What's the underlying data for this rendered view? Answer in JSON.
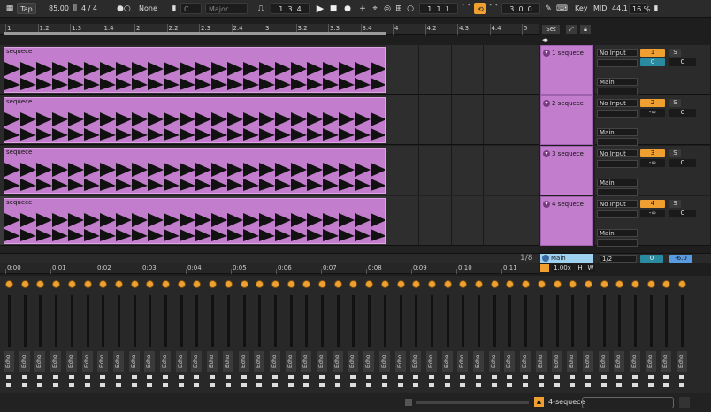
{
  "transport": {
    "tap": "Tap",
    "tempo": "85.00",
    "time_sig": "4 / 4",
    "quantize": "None",
    "key_root": "C",
    "scale": "Major",
    "position": "1.  3.  4",
    "loop_start": "1.  1.  1",
    "loop_length": "3.  0.  0",
    "key_label": "Key",
    "midi_label": "MIDI",
    "sample_rate": "44.1",
    "cpu": "16 %"
  },
  "ruler": {
    "bar_labels": [
      "1",
      "1.2",
      "1.3",
      "1.4",
      "2",
      "2.2",
      "2.3",
      "2.4",
      "3",
      "3.2",
      "3.3",
      "3.4",
      "4",
      "4.2",
      "4.3",
      "4.4",
      "5"
    ]
  },
  "right_panel": {
    "set_label": "Set"
  },
  "tracks": [
    {
      "clip_name": "sequece",
      "track_name": "1 sequece",
      "input": "No Input",
      "output": "Main",
      "number": "1",
      "volume": "0",
      "s": "S",
      "c": "C",
      "armed": true
    },
    {
      "clip_name": "sequece",
      "track_name": "2 sequece",
      "input": "No Input",
      "output": "Main",
      "number": "2",
      "volume": "-∞",
      "s": "S",
      "c": "C",
      "armed": false
    },
    {
      "clip_name": "sequece",
      "track_name": "3 sequece",
      "input": "No Input",
      "output": "Main",
      "number": "3",
      "volume": "-∞",
      "s": "S",
      "c": "C",
      "armed": false
    },
    {
      "clip_name": "sequece",
      "track_name": "4 sequece",
      "input": "No Input",
      "output": "Main",
      "number": "4",
      "volume": "-∞",
      "s": "S",
      "c": "C",
      "armed": false
    }
  ],
  "main_track": {
    "zoom": "1/8",
    "name": "Main",
    "fraction": "1/2",
    "volume": "0",
    "pan": "-6.0",
    "speed": "1.00x",
    "h": "H",
    "w": "W"
  },
  "timebar": {
    "labels": [
      "0:00",
      "0:01",
      "0:02",
      "0:03",
      "0:04",
      "0:05",
      "0:06",
      "0:07",
      "0:08",
      "0:09",
      "0:10",
      "0:11"
    ]
  },
  "mixer": {
    "strip_label": "Echo",
    "strip_count": 44
  },
  "statusbar": {
    "clip_name": "4-sequece"
  }
}
